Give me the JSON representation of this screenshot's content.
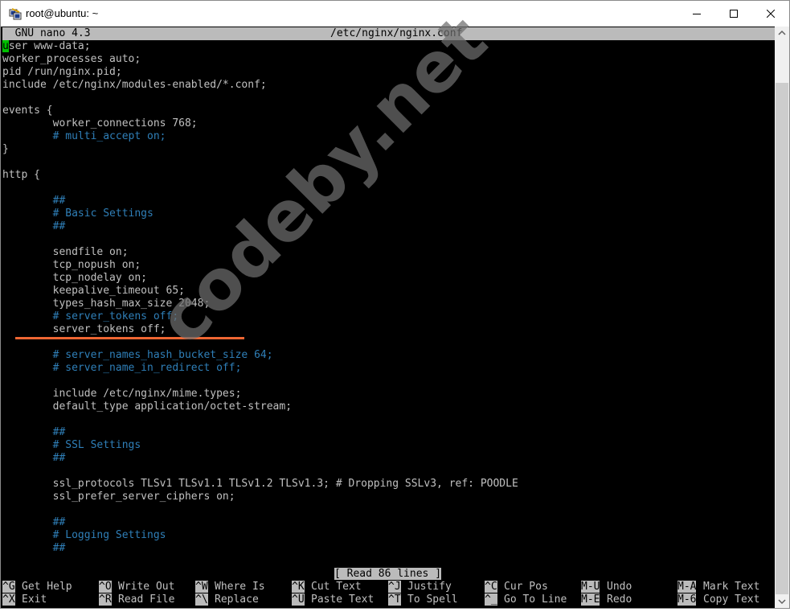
{
  "window": {
    "title": "root@ubuntu: ~"
  },
  "nano": {
    "version": "  GNU nano 4.3",
    "filename": "/etc/nginx/nginx.conf",
    "status": "[ Read 86 lines ]"
  },
  "editor": {
    "lines": [
      {
        "text": "user www-data;",
        "style": "code"
      },
      {
        "text": "worker_processes auto;",
        "style": "code"
      },
      {
        "text": "pid /run/nginx.pid;",
        "style": "code"
      },
      {
        "text": "include /etc/nginx/modules-enabled/*.conf;",
        "style": "code"
      },
      {
        "text": "",
        "style": "code"
      },
      {
        "text": "events {",
        "style": "code"
      },
      {
        "text": "        worker_connections 768;",
        "style": "code"
      },
      {
        "text": "        # multi_accept on;",
        "style": "comment"
      },
      {
        "text": "}",
        "style": "code"
      },
      {
        "text": "",
        "style": "code"
      },
      {
        "text": "http {",
        "style": "code"
      },
      {
        "text": "",
        "style": "code"
      },
      {
        "text": "        ##",
        "style": "comment"
      },
      {
        "text": "        # Basic Settings",
        "style": "comment"
      },
      {
        "text": "        ##",
        "style": "comment"
      },
      {
        "text": "",
        "style": "code"
      },
      {
        "text": "        sendfile on;",
        "style": "code"
      },
      {
        "text": "        tcp_nopush on;",
        "style": "code"
      },
      {
        "text": "        tcp_nodelay on;",
        "style": "code"
      },
      {
        "text": "        keepalive_timeout 65;",
        "style": "code"
      },
      {
        "text": "        types_hash_max_size 2048;",
        "style": "code"
      },
      {
        "text": "        # server_tokens off;",
        "style": "comment"
      },
      {
        "text": "        server_tokens off;",
        "style": "code"
      },
      {
        "text": "",
        "style": "code"
      },
      {
        "text": "        # server_names_hash_bucket_size 64;",
        "style": "comment"
      },
      {
        "text": "        # server_name_in_redirect off;",
        "style": "comment"
      },
      {
        "text": "",
        "style": "code"
      },
      {
        "text": "        include /etc/nginx/mime.types;",
        "style": "code"
      },
      {
        "text": "        default_type application/octet-stream;",
        "style": "code"
      },
      {
        "text": "",
        "style": "code"
      },
      {
        "text": "        ##",
        "style": "comment"
      },
      {
        "text": "        # SSL Settings",
        "style": "comment"
      },
      {
        "text": "        ##",
        "style": "comment"
      },
      {
        "text": "",
        "style": "code"
      },
      {
        "text": "        ssl_protocols TLSv1 TLSv1.1 TLSv1.2 TLSv1.3; # Dropping SSLv3, ref: POODLE",
        "style": "code"
      },
      {
        "text": "        ssl_prefer_server_ciphers on;",
        "style": "code"
      },
      {
        "text": "",
        "style": "code"
      },
      {
        "text": "        ##",
        "style": "comment"
      },
      {
        "text": "        # Logging Settings",
        "style": "comment"
      },
      {
        "text": "        ##",
        "style": "comment"
      },
      {
        "text": "",
        "style": "code"
      }
    ]
  },
  "shortcuts": {
    "row1": [
      {
        "key": "^G",
        "label": "Get Help"
      },
      {
        "key": "^O",
        "label": "Write Out"
      },
      {
        "key": "^W",
        "label": "Where Is"
      },
      {
        "key": "^K",
        "label": "Cut Text"
      },
      {
        "key": "^J",
        "label": "Justify"
      },
      {
        "key": "^C",
        "label": "Cur Pos"
      },
      {
        "key": "M-U",
        "label": "Undo"
      },
      {
        "key": "M-A",
        "label": "Mark Text"
      }
    ],
    "row2": [
      {
        "key": "^X",
        "label": "Exit"
      },
      {
        "key": "^R",
        "label": "Read File"
      },
      {
        "key": "^\\",
        "label": "Replace"
      },
      {
        "key": "^U",
        "label": "Paste Text"
      },
      {
        "key": "^T",
        "label": "To Spell"
      },
      {
        "key": "^_",
        "label": "Go To Line"
      },
      {
        "key": "M-E",
        "label": "Redo"
      },
      {
        "key": "M-6",
        "label": "Copy Text"
      }
    ]
  },
  "watermark": "codeby.net",
  "colors": {
    "comment": "#2f7fb8",
    "cursor": "#00c000",
    "bar": "#bbbbbb",
    "underline": "#ee6633"
  }
}
